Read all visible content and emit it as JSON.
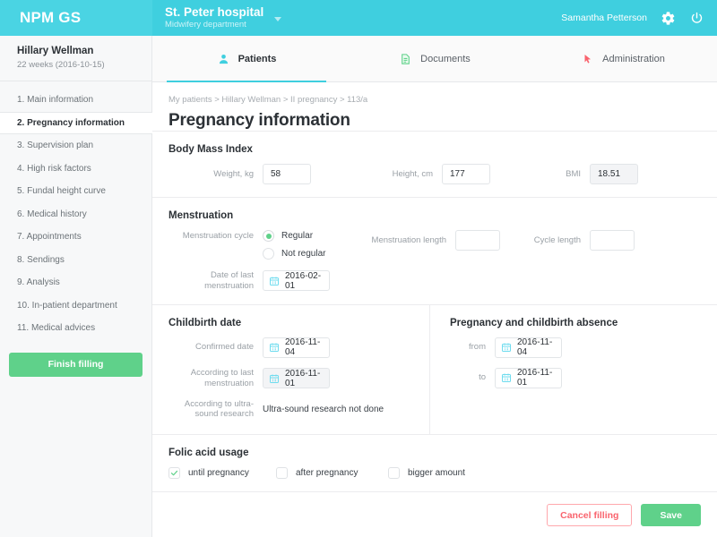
{
  "brand": {
    "name": "NPM GS"
  },
  "topbar": {
    "hospital_name": "St. Peter hospital",
    "hospital_department": "Midwifery department",
    "hospital_dropdown_icon": "chevron-down-icon",
    "user_name": "Samantha Petterson",
    "settings_icon": "gear-icon",
    "power_icon": "power-icon"
  },
  "sidebar": {
    "patient_name": "Hillary Wellman",
    "patient_sub": "22 weeks (2016-10-15)",
    "items": [
      {
        "label": "1. Main information",
        "active": false
      },
      {
        "label": "2. Pregnancy information",
        "active": true
      },
      {
        "label": "3. Supervision plan",
        "active": false
      },
      {
        "label": "4. High risk factors",
        "active": false
      },
      {
        "label": "5. Fundal height curve",
        "active": false
      },
      {
        "label": "6. Medical history",
        "active": false
      },
      {
        "label": "7. Appointments",
        "active": false
      },
      {
        "label": "8. Sendings",
        "active": false
      },
      {
        "label": "9. Analysis",
        "active": false
      },
      {
        "label": "10. In-patient department",
        "active": false
      },
      {
        "label": "11. Medical advices",
        "active": false
      }
    ],
    "finish_label": "Finish filling",
    "finish_color": "#5fd18a"
  },
  "tabs": [
    {
      "label": "Patients",
      "icon": "user-icon",
      "active": true,
      "color": "#3fcfdf"
    },
    {
      "label": "Documents",
      "icon": "document-icon",
      "active": false,
      "color": "#5fd18a"
    },
    {
      "label": "Administration",
      "icon": "cursor-arrow-icon",
      "active": false,
      "color": "#f9636d"
    }
  ],
  "breadcrumb": "My patients > Hillary Wellman > II pregnancy > 113/a",
  "page_title": "Pregnancy information",
  "bmi_section": {
    "title": "Body Mass Index",
    "weight_label": "Weight, kg",
    "weight_value": "58",
    "height_label": "Height, cm",
    "height_value": "177",
    "bmi_label": "BMI",
    "bmi_value": "18.51"
  },
  "menstruation_section": {
    "title": "Menstruation",
    "cycle_label": "Menstruation cycle",
    "cycle_options": [
      {
        "label": "Regular",
        "selected": true
      },
      {
        "label": "Not regular",
        "selected": false
      }
    ],
    "length_label": "Menstruation length",
    "length_value": "",
    "length_placeholder": "",
    "cycle_length_label": "Cycle length",
    "cycle_length_value": "",
    "cycle_length_placeholder": "",
    "last_menstruation_label": "Date of last menstruation",
    "last_menstruation_value": "2016-02-01",
    "calendar_icon": "calendar-icon"
  },
  "childbirth_section": {
    "title": "Childbirth date",
    "confirmed_label": "Confirmed date",
    "confirmed_value": "2016-11-04",
    "according_menstruation_label": "According to last menstruation",
    "according_menstruation_value": "2016-11-01",
    "according_ultrasound_label": "According to ultra-sound research",
    "according_ultrasound_value": "Ultra-sound research not done"
  },
  "absence_section": {
    "title": "Pregnancy and childbirth absence",
    "from_label": "from",
    "from_value": "2016-11-04",
    "to_label": "to",
    "to_value": "2016-11-01"
  },
  "folic_section": {
    "title": "Folic acid usage",
    "options": [
      {
        "label": "until pregnancy",
        "checked": true
      },
      {
        "label": "after pregnancy",
        "checked": false
      },
      {
        "label": "bigger amount",
        "checked": false
      }
    ],
    "check_color": "#5fd18a"
  },
  "footer": {
    "cancel_label": "Cancel filling",
    "save_label": "Save",
    "cancel_color": "#f9636d",
    "save_color": "#5fd18a"
  }
}
